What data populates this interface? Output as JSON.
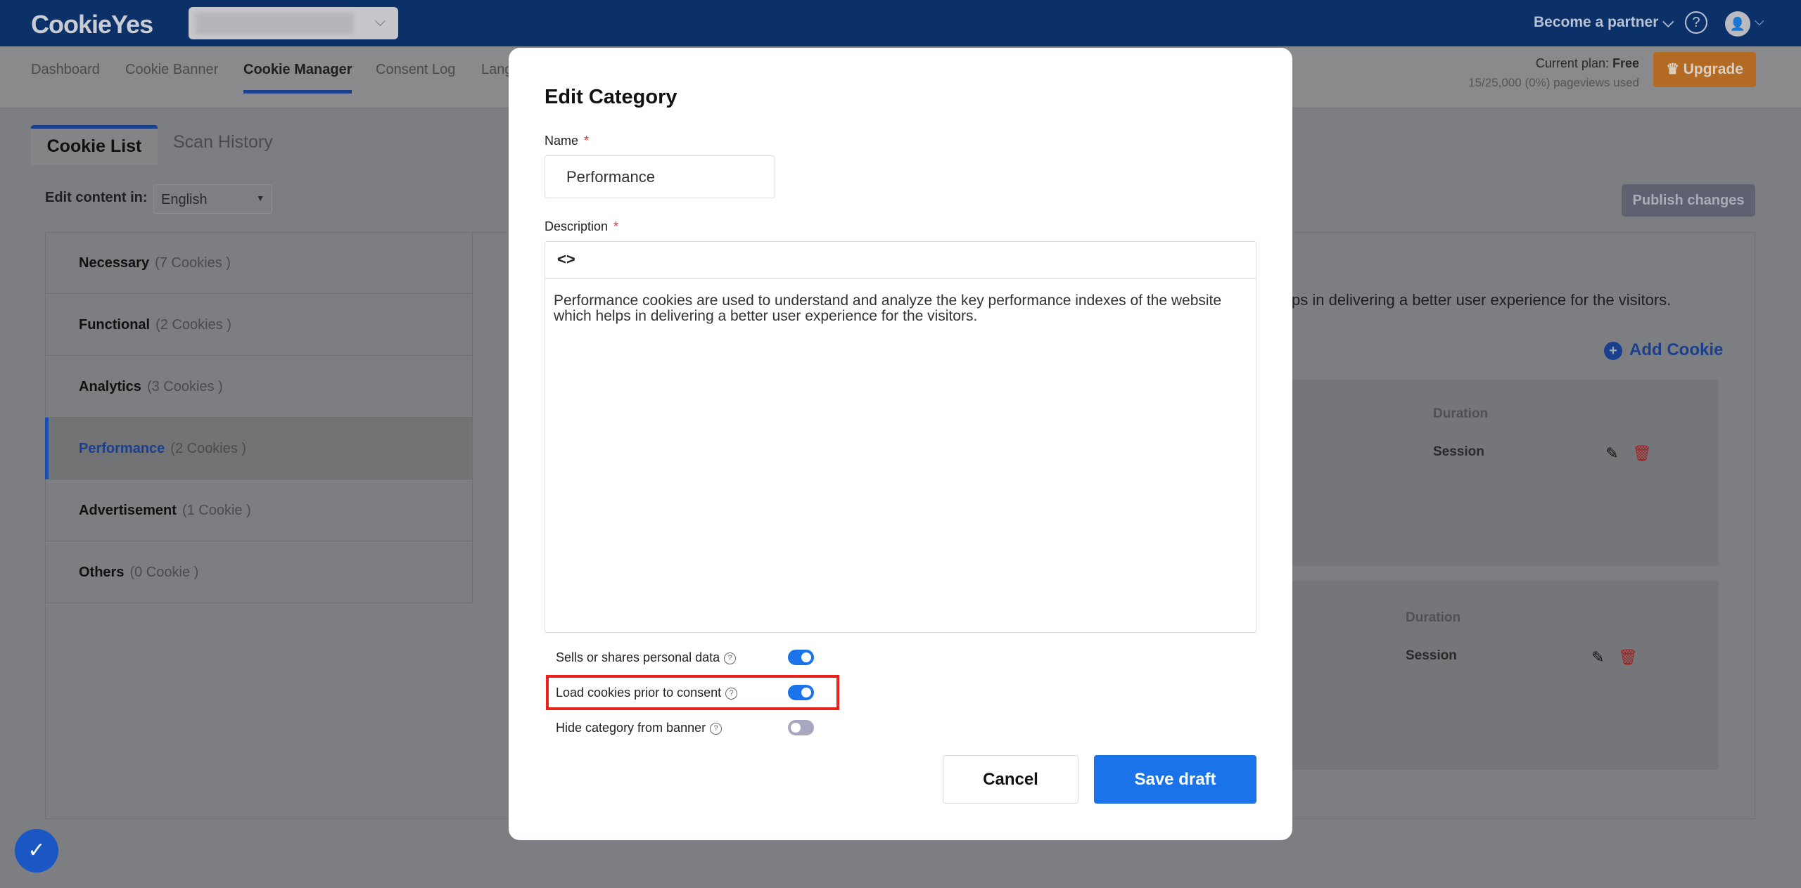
{
  "header": {
    "logo": "CookieYes",
    "become_partner": "Become a partner ⌵",
    "help_icon": "?",
    "avatar_icon": "user-icon"
  },
  "nav": {
    "tabs": [
      "Dashboard",
      "Cookie Banner",
      "Cookie Manager",
      "Consent Log",
      "Lang"
    ],
    "active": "Cookie Manager"
  },
  "plan": {
    "label": "Current plan: ",
    "value": "Free",
    "usage": "15/25,000 (0%) pageviews used",
    "upgrade": "♛ Upgrade"
  },
  "content_tabs": {
    "cookie_list": "Cookie List",
    "scan_history": "Scan History"
  },
  "edit_content": {
    "label": "Edit content in:",
    "language": "English"
  },
  "publish": "Publish changes",
  "categories": [
    {
      "name": "Necessary",
      "count": "(7 Cookies )"
    },
    {
      "name": "Functional",
      "count": "(2 Cookies )"
    },
    {
      "name": "Analytics",
      "count": "(3 Cookies )"
    },
    {
      "name": "Performance",
      "count": "(2 Cookies )"
    },
    {
      "name": "Advertisement",
      "count": "(1 Cookie )"
    },
    {
      "name": "Others",
      "count": "(0 Cookie )"
    }
  ],
  "background_desc": "ps in delivering a better user experience for the visitors.",
  "add_cookie": "Add Cookie",
  "cookie_tables": [
    {
      "duration_header": "Duration",
      "duration": "Session"
    },
    {
      "duration_header": "Duration",
      "duration": "Session"
    }
  ],
  "modal": {
    "title": "Edit Category",
    "name_label": "Name",
    "name_value": "Performance",
    "description_label": "Description",
    "required": "*",
    "code_icon": "<>",
    "description": "Performance cookies are used to understand and analyze the key performance indexes of the website which helps in delivering a better user experience for the visitors.",
    "toggles": [
      {
        "label": "Sells or shares personal data",
        "on": true
      },
      {
        "label": "Load cookies prior to consent",
        "on": true
      },
      {
        "label": "Hide category from banner",
        "on": false
      }
    ],
    "cancel": "Cancel",
    "save": "Save draft"
  },
  "colors": {
    "primary": "#1a73e8",
    "highlight": "#e8231a",
    "topbar": "#0c3068"
  }
}
